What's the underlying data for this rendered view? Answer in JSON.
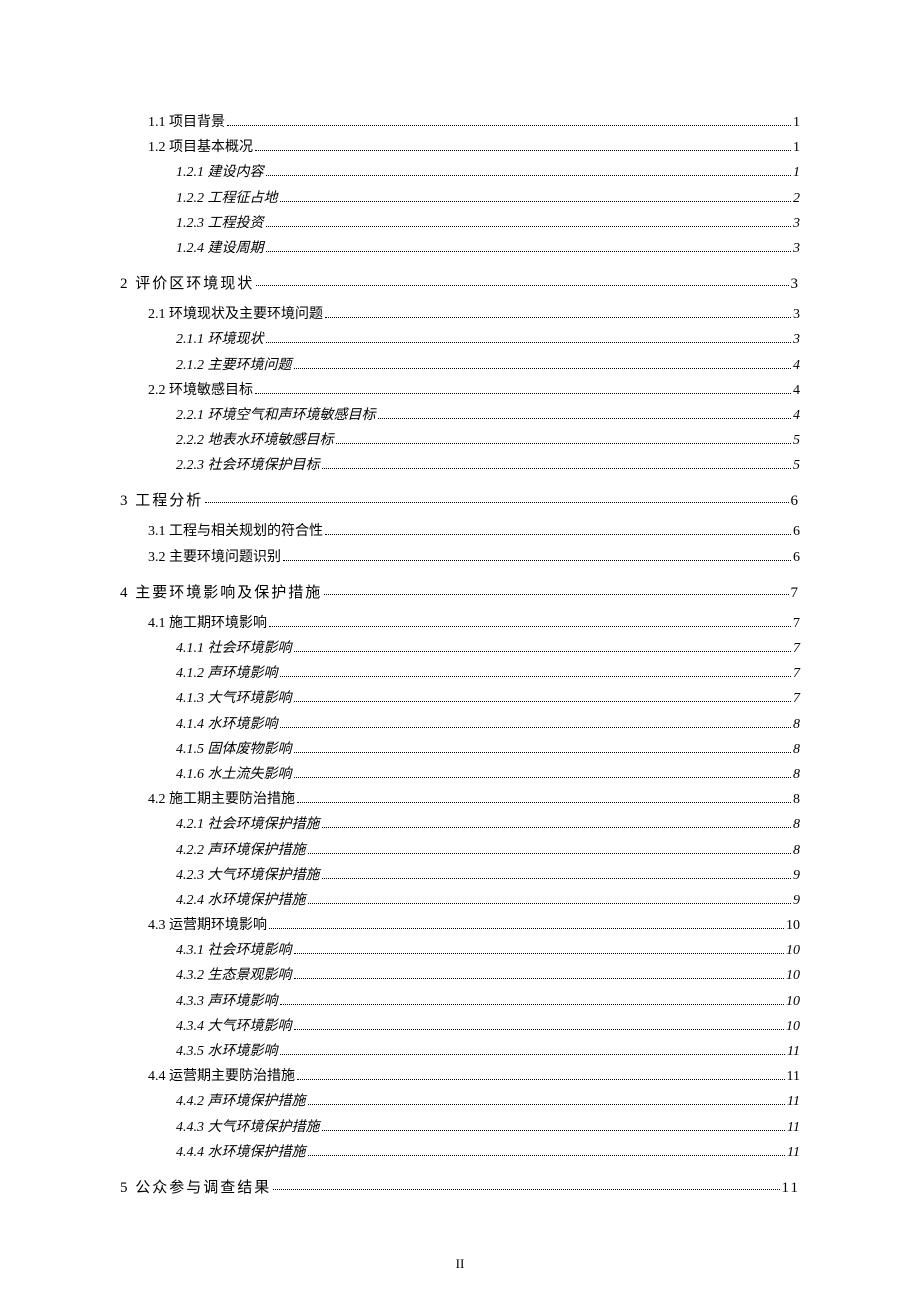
{
  "page_number": "II",
  "toc": [
    {
      "lvl": 2,
      "label": "1.1 项目背景",
      "page": "1"
    },
    {
      "lvl": 2,
      "label": "1.2 项目基本概况",
      "page": "1"
    },
    {
      "lvl": 3,
      "label": "1.2.1 建设内容",
      "page": "1"
    },
    {
      "lvl": 3,
      "label": "1.2.2 工程征占地",
      "page": "2"
    },
    {
      "lvl": 3,
      "label": "1.2.3 工程投资",
      "page": "3"
    },
    {
      "lvl": 3,
      "label": "1.2.4 建设周期",
      "page": "3"
    },
    {
      "lvl": 1,
      "label": "2 评价区环境现状",
      "page": "3"
    },
    {
      "lvl": 2,
      "label": "2.1 环境现状及主要环境问题",
      "page": "3"
    },
    {
      "lvl": 3,
      "label": "2.1.1 环境现状",
      "page": "3"
    },
    {
      "lvl": 3,
      "label": "2.1.2 主要环境问题",
      "page": "4"
    },
    {
      "lvl": 2,
      "label": "2.2 环境敏感目标",
      "page": "4"
    },
    {
      "lvl": 3,
      "label": "2.2.1 环境空气和声环境敏感目标",
      "page": "4"
    },
    {
      "lvl": 3,
      "label": "2.2.2 地表水环境敏感目标",
      "page": "5"
    },
    {
      "lvl": 3,
      "label": "2.2.3 社会环境保护目标",
      "page": "5"
    },
    {
      "lvl": 1,
      "label": "3 工程分析",
      "page": "6"
    },
    {
      "lvl": 2,
      "label": "3.1 工程与相关规划的符合性",
      "page": "6"
    },
    {
      "lvl": 2,
      "label": "3.2 主要环境问题识别",
      "page": "6"
    },
    {
      "lvl": 1,
      "label": "4 主要环境影响及保护措施",
      "page": "7"
    },
    {
      "lvl": 2,
      "label": "4.1 施工期环境影响",
      "page": "7"
    },
    {
      "lvl": 3,
      "label": "4.1.1 社会环境影响",
      "page": "7"
    },
    {
      "lvl": 3,
      "label": "4.1.2 声环境影响",
      "page": "7"
    },
    {
      "lvl": 3,
      "label": "4.1.3 大气环境影响",
      "page": "7"
    },
    {
      "lvl": 3,
      "label": "4.1.4 水环境影响",
      "page": "8"
    },
    {
      "lvl": 3,
      "label": "4.1.5 固体废物影响",
      "page": "8"
    },
    {
      "lvl": 3,
      "label": "4.1.6 水土流失影响",
      "page": "8"
    },
    {
      "lvl": 2,
      "label": "4.2 施工期主要防治措施",
      "page": "8"
    },
    {
      "lvl": 3,
      "label": "4.2.1 社会环境保护措施",
      "page": "8"
    },
    {
      "lvl": 3,
      "label": "4.2.2 声环境保护措施",
      "page": "8"
    },
    {
      "lvl": 3,
      "label": "4.2.3 大气环境保护措施",
      "page": "9"
    },
    {
      "lvl": 3,
      "label": "4.2.4 水环境保护措施",
      "page": "9"
    },
    {
      "lvl": 2,
      "label": "4.3 运营期环境影响",
      "page": "10"
    },
    {
      "lvl": 3,
      "label": "4.3.1 社会环境影响",
      "page": "10"
    },
    {
      "lvl": 3,
      "label": "4.3.2 生态景观影响",
      "page": "10"
    },
    {
      "lvl": 3,
      "label": "4.3.3 声环境影响",
      "page": "10"
    },
    {
      "lvl": 3,
      "label": "4.3.4 大气环境影响",
      "page": "10"
    },
    {
      "lvl": 3,
      "label": "4.3.5 水环境影响",
      "page": "11"
    },
    {
      "lvl": 2,
      "label": "4.4 运营期主要防治措施",
      "page": "11"
    },
    {
      "lvl": 3,
      "label": "4.4.2 声环境保护措施",
      "page": "11"
    },
    {
      "lvl": 3,
      "label": "4.4.3 大气环境保护措施",
      "page": "11"
    },
    {
      "lvl": 3,
      "label": "4.4.4 水环境保护措施",
      "page": "11"
    },
    {
      "lvl": 1,
      "label": "5 公众参与调查结果",
      "page": "11"
    }
  ]
}
